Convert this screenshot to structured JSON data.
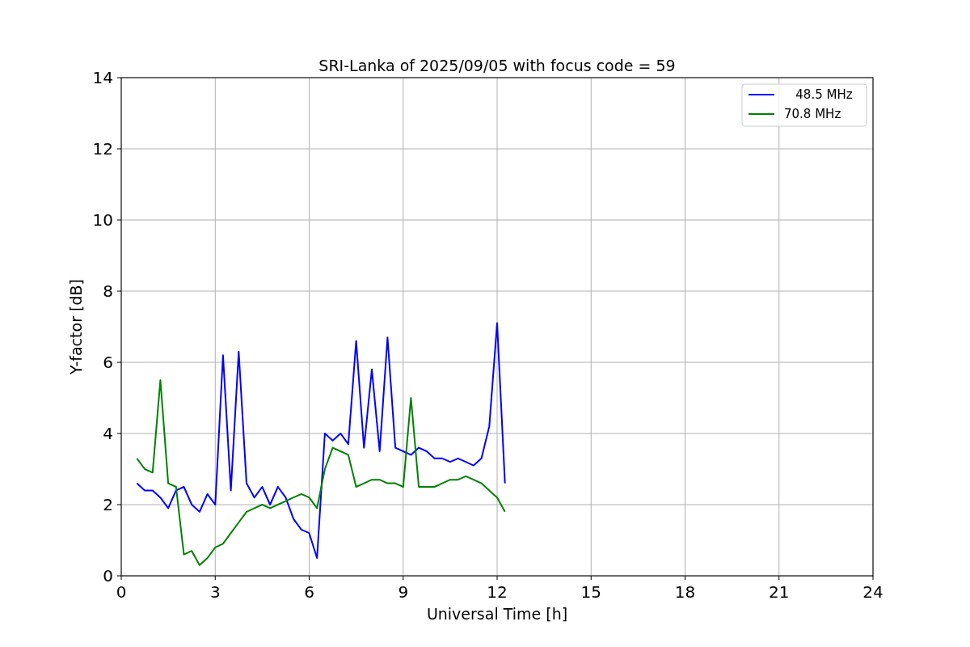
{
  "chart_data": {
    "type": "line",
    "title": "SRI-Lanka of 2025/09/05 with focus code = 59",
    "xlabel": "Universal Time [h]",
    "ylabel": "Y-factor [dB]",
    "x": [
      0.5,
      0.75,
      1.0,
      1.25,
      1.5,
      1.75,
      2.0,
      2.25,
      2.5,
      2.75,
      3.0,
      3.25,
      3.5,
      3.75,
      4.0,
      4.25,
      4.5,
      4.75,
      5.0,
      5.25,
      5.5,
      5.75,
      6.0,
      6.25,
      6.5,
      6.75,
      7.0,
      7.25,
      7.5,
      7.75,
      8.0,
      8.25,
      8.5,
      8.75,
      9.0,
      9.25,
      9.5,
      9.75,
      10.0,
      10.25,
      10.5,
      10.75,
      11.0,
      11.25,
      11.5,
      11.75,
      12.0,
      12.25
    ],
    "series": [
      {
        "name": "   48.5 MHz",
        "color": "#0000ff",
        "values": [
          2.6,
          2.4,
          2.4,
          2.2,
          1.9,
          2.4,
          2.5,
          2.0,
          1.8,
          2.3,
          2.0,
          6.2,
          2.4,
          6.3,
          2.6,
          2.2,
          2.5,
          2.0,
          2.5,
          2.2,
          1.6,
          1.3,
          1.2,
          0.5,
          4.0,
          3.8,
          4.0,
          3.7,
          6.6,
          3.6,
          5.8,
          3.5,
          6.7,
          3.6,
          3.5,
          3.4,
          3.6,
          3.5,
          3.3,
          3.3,
          3.2,
          3.3,
          3.2,
          3.1,
          3.3,
          4.2,
          7.1,
          2.6
        ]
      },
      {
        "name": "70.8 MHz",
        "color": "#008000",
        "values": [
          3.3,
          3.0,
          2.9,
          5.5,
          2.6,
          2.5,
          0.6,
          0.7,
          0.3,
          0.5,
          0.8,
          0.9,
          1.2,
          1.5,
          1.8,
          1.9,
          2.0,
          1.9,
          2.0,
          2.1,
          2.2,
          2.3,
          2.2,
          1.9,
          3.0,
          3.6,
          3.5,
          3.4,
          2.5,
          2.6,
          2.7,
          2.7,
          2.6,
          2.6,
          2.5,
          5.0,
          2.5,
          2.5,
          2.5,
          2.6,
          2.7,
          2.7,
          2.8,
          2.7,
          2.6,
          2.4,
          2.2,
          1.8
        ]
      }
    ],
    "grid": true,
    "legend": true,
    "xlim": [
      0,
      24
    ],
    "ylim": [
      0,
      14
    ],
    "xticks": [
      0,
      3,
      6,
      9,
      12,
      15,
      18,
      21,
      24
    ],
    "yticks": [
      0,
      2,
      4,
      6,
      8,
      10,
      12,
      14
    ]
  }
}
